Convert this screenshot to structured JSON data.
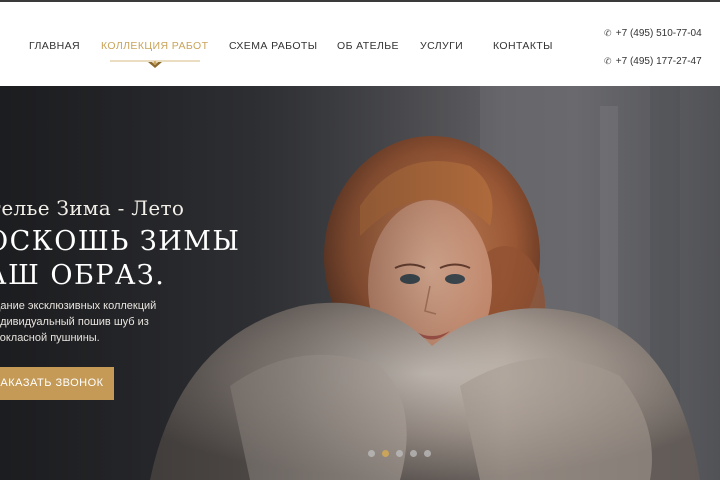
{
  "nav": {
    "items": [
      {
        "label": "ГЛАВНАЯ",
        "active": false
      },
      {
        "label": "КОЛЛЕКЦИЯ РАБОТ",
        "active": true
      },
      {
        "label": "СХЕМА РАБОТЫ",
        "active": false
      },
      {
        "label": "ОБ  АТЕЛЬЕ",
        "active": false
      },
      {
        "label": "УСЛУГИ",
        "active": false
      },
      {
        "label": "КОНТАКТЫ",
        "active": false
      }
    ]
  },
  "contacts": {
    "phone_icon": "phone-icon",
    "phones": [
      "+7 (495) 510-77-04",
      "+7 (495) 177-27-47"
    ]
  },
  "hero": {
    "subtitle": "телье Зима - Лето",
    "headline_line1": "ОСКОШЬ ЗИМЫ",
    "headline_line2": "АШ ОБРАЗ.",
    "description": [
      "дание эксклюзивных коллекций",
      "ндивидуальный пошив шуб из",
      "вокласной пушнины."
    ],
    "cta_label": "АКАЗАТЬ ЗВОНОК",
    "slider": {
      "count": 5,
      "active_index": 1
    }
  },
  "colors": {
    "accent": "#c9a45a",
    "button": "#c49a56",
    "text_dark": "#333333",
    "hero_text": "#ffffff"
  }
}
